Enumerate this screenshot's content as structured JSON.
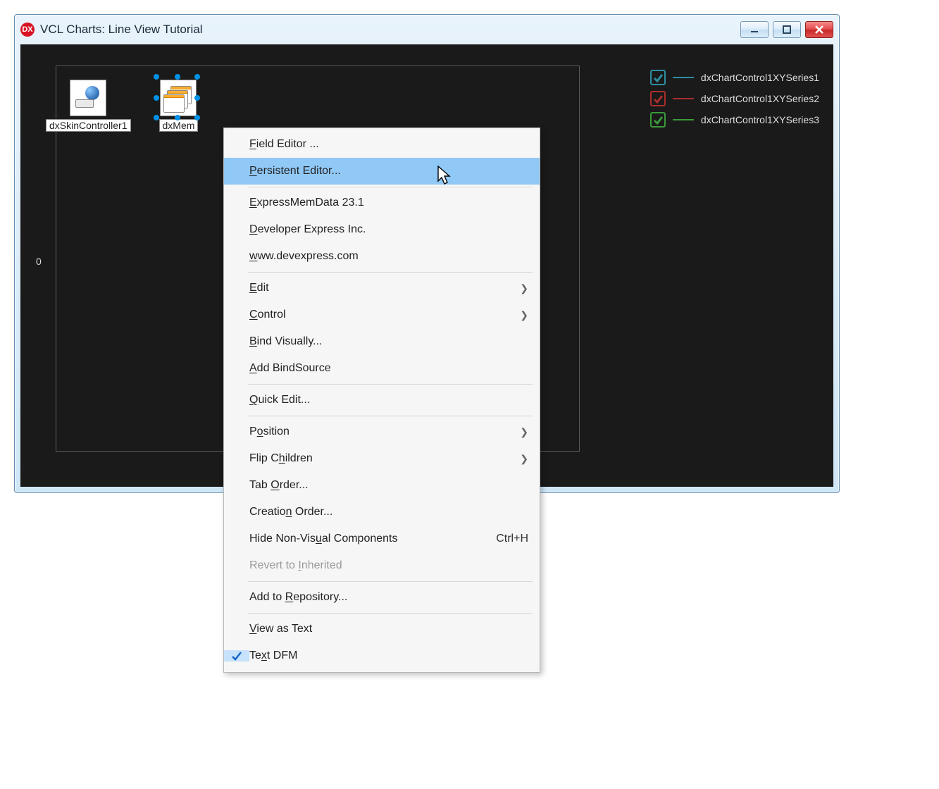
{
  "window": {
    "app_icon_label": "DX",
    "title": "VCL Charts: Line View Tutorial"
  },
  "axis": {
    "zero_label": "0"
  },
  "tray": {
    "skin_label": "dxSkinController1",
    "mem_label": "dxMem"
  },
  "legend": {
    "items": [
      {
        "label": "dxChartControl1XYSeries1",
        "color": "#2e8da0"
      },
      {
        "label": "dxChartControl1XYSeries2",
        "color": "#aa2d2d"
      },
      {
        "label": "dxChartControl1XYSeries3",
        "color": "#3a9a3a"
      }
    ]
  },
  "menu": {
    "field_editor": "Field Editor ...",
    "persistent_editor": "Persistent Editor...",
    "express_memdata": "ExpressMemData 23.1",
    "developer": "Developer Express Inc.",
    "website": "www.devexpress.com",
    "edit": "Edit",
    "control": "Control",
    "bind_visually": "Bind Visually...",
    "add_bindsource": "Add BindSource",
    "quick_edit": "Quick Edit...",
    "position": "Position",
    "flip_children": "Flip Children",
    "tab_order": "Tab Order...",
    "creation_order": "Creation Order...",
    "hide_nonvisual": "Hide Non-Visual Components",
    "hide_nonvisual_shortcut": "Ctrl+H",
    "revert": "Revert to Inherited",
    "add_repo": "Add to Repository...",
    "view_text": "View as Text",
    "text_dfm": "Text DFM"
  }
}
